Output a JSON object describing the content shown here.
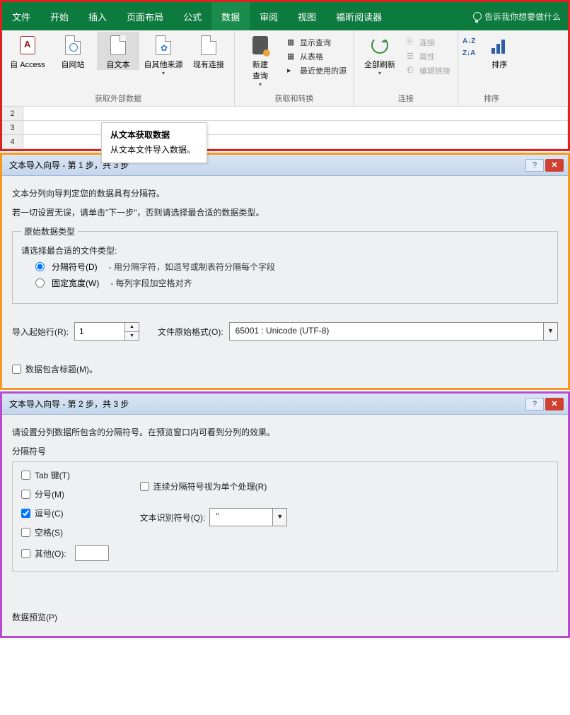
{
  "tabs": [
    "文件",
    "开始",
    "插入",
    "页面布局",
    "公式",
    "数据",
    "审阅",
    "视图",
    "福昕阅读器"
  ],
  "active_tab": "数据",
  "tell_me": "告诉我你想要做什么",
  "group1": {
    "label": "获取外部数据",
    "btns": [
      "自 Access",
      "自网站",
      "自文本",
      "自其他来源",
      "现有连接"
    ]
  },
  "group2": {
    "label": "获取和转换",
    "main": "新建\n查询",
    "items": [
      "显示查询",
      "从表格",
      "最近使用的源"
    ]
  },
  "group3": {
    "label": "连接",
    "main": "全部刷新",
    "items": [
      "连接",
      "属性",
      "编辑链接"
    ]
  },
  "group4": {
    "label": "排序",
    "btn": "排序"
  },
  "rows": [
    "2",
    "3",
    "4"
  ],
  "tooltip": {
    "title": "从文本获取数据",
    "body": "从文本文件导入数据。"
  },
  "dlg1": {
    "title": "文本导入向导 - 第 1 步，共 3 步",
    "p1": "文本分列向导判定您的数据具有分隔符。",
    "p2": "若一切设置无误，请单击\"下一步\"，否则请选择最合适的数据类型。",
    "legend": "原始数据类型",
    "prompt": "请选择最合适的文件类型:",
    "opt1": "分隔符号(D)",
    "opt1d": "- 用分隔字符，如逗号或制表符分隔每个字段",
    "opt2": "固定宽度(W)",
    "opt2d": "- 每列字段加空格对齐",
    "start_row_lbl": "导入起始行(R):",
    "start_row_val": "1",
    "enc_lbl": "文件原始格式(O):",
    "enc_val": "65001 : Unicode (UTF-8)",
    "has_header": "数据包含标题(M)。"
  },
  "dlg2": {
    "title": "文本导入向导 - 第 2 步，共 3 步",
    "p1": "请设置分列数据所包含的分隔符号。在预览窗口内可看到分列的效果。",
    "legend": "分隔符号",
    "c_tab": "Tab 键(T)",
    "c_semi": "分号(M)",
    "c_comma": "逗号(C)",
    "c_space": "空格(S)",
    "c_other": "其他(O):",
    "treat_consec": "连续分隔符号视为单个处理(R)",
    "text_qual_lbl": "文本识别符号(Q):",
    "text_qual_val": "\"",
    "preview_lbl": "数据预览(P)"
  }
}
